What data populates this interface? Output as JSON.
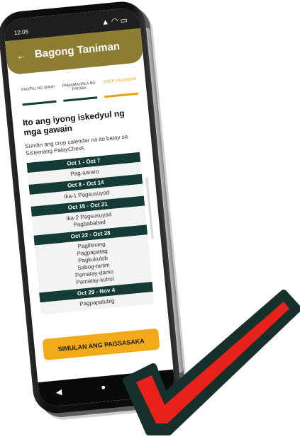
{
  "status": {
    "time": "12:05",
    "icons": [
      "signal-icon",
      "wifi-icon",
      "battery-icon"
    ]
  },
  "appbar": {
    "back_icon": "arrow-left-icon",
    "title": "Bagong Taniman"
  },
  "steps": [
    {
      "label": "PAGPILI NG BINHI",
      "active": false
    },
    {
      "label": "PAMAMAHALA NG PATABA",
      "active": false
    },
    {
      "label": "CROP CALENDAR",
      "active": true
    }
  ],
  "main": {
    "heading": "Ito ang iyong iskedyul ng mga gawain",
    "subheading": "Sundin ang crop calendar na ito batay sa Sistemang PalayCheck."
  },
  "schedule": [
    {
      "week": "Oct 1 - Oct 7",
      "tasks": [
        "Pag-aararo"
      ]
    },
    {
      "week": "Oct 8 - Oct 14",
      "tasks": [
        "Ika-1 Pagsusuyod"
      ]
    },
    {
      "week": "Oct 15 - Oct 21",
      "tasks": [
        "Ika-2 Pagsusuyod",
        "Pagbababad"
      ]
    },
    {
      "week": "Oct 22 - Oct 28",
      "tasks": [
        "Paglilinang",
        "Pagpapatag",
        "Pagkukulob",
        "Sabog-tanim",
        "Pamatay-damo",
        "Pamatay-kuhol"
      ]
    },
    {
      "week": "Oct 29 - Nov 4",
      "tasks": [
        "Pagpapatubig"
      ]
    }
  ],
  "cta": {
    "label": "SIMULAN ANG PAGSASAKA"
  },
  "navbar": {
    "back_icon": "triangle-back-icon",
    "home_icon": "circle-home-icon",
    "recents_icon": "square-recents-icon"
  },
  "colors": {
    "appbar": "#8c7d32",
    "dark_green": "#153b36",
    "accent": "#f0aa1a",
    "check_red": "#e8221b",
    "check_outline": "#16302c"
  }
}
